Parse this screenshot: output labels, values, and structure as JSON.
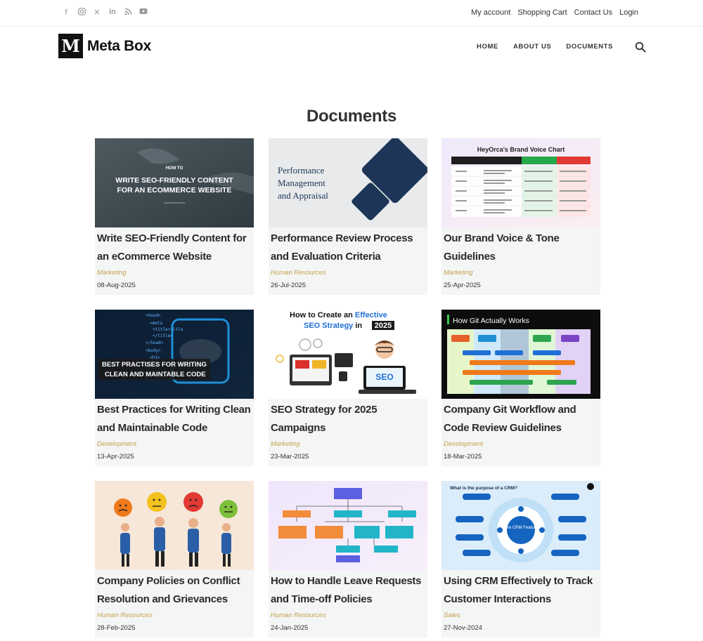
{
  "top_links": [
    "My account",
    "Shopping Cart",
    "Contact Us",
    "Login"
  ],
  "social_icons": [
    "facebook-icon",
    "instagram-icon",
    "x-icon",
    "linkedin-icon",
    "rss-icon",
    "youtube-icon"
  ],
  "logo": {
    "mark": "M",
    "text": "Meta Box"
  },
  "nav": [
    "HOME",
    "ABOUT US",
    "DOCUMENTS"
  ],
  "page_title": "Documents",
  "colors": {
    "category": "#c2a24a",
    "card_bg": "#f4f5f5",
    "text": "#2a2a2a"
  },
  "cards": [
    {
      "title": "Write SEO-Friendly Content for an eCommerce Website",
      "category": "Marketing",
      "date": "08-Aug-2025",
      "image": {
        "kicker": "HOW TO",
        "line1": "WRITE SEO-FRIENDLY CONTENT",
        "line2": "FOR AN ECOMMERCE WEBSITE"
      }
    },
    {
      "title": "Performance Review Process and Evaluation Criteria",
      "category": "Human Resources",
      "date": "26-Jul-2025",
      "image": {
        "line1": "Performance",
        "line2": "Management",
        "line3": "and Appraisal"
      }
    },
    {
      "title": "Our Brand Voice & Tone Guidelines",
      "category": "Marketing",
      "date": "25-Apr-2025",
      "image": {
        "heading": "HeyOrca's Brand Voice Chart"
      }
    },
    {
      "title": "Best Practices for Writing Clean and Maintainable Code",
      "category": "Development",
      "date": "13-Apr-2025",
      "image": {
        "line1": "BEST PRACTISES FOR WRITING",
        "line2": "CLEAN AND MAINTABLE CODE",
        "code": [
          "<head>",
          "<meta",
          "<title>title",
          "</title>",
          "</head>",
          "<body>",
          "<h1>"
        ]
      }
    },
    {
      "title": "SEO Strategy for 2025 Campaigns",
      "category": "Marketing",
      "date": "23-Mar-2025",
      "image": {
        "line1a": "How to Create an ",
        "line1b": "Effective",
        "line2a": "SEO Strategy",
        "line2b": " in ",
        "line2c": "2025",
        "badge": "SEO"
      }
    },
    {
      "title": "Company Git Workflow and Code Review Guidelines",
      "category": "Development",
      "date": "18-Mar-2025",
      "image": {
        "heading": "How Git Actually Works"
      }
    },
    {
      "title": "Company Policies on Conflict Resolution and Grievances",
      "category": "Human Resources",
      "date": "28-Feb-2025",
      "image": {}
    },
    {
      "title": "How to Handle Leave Requests and Time-off Policies",
      "category": "Human Resources",
      "date": "24-Jan-2025",
      "image": {}
    },
    {
      "title": "Using CRM Effectively to Track Customer Interactions",
      "category": "Sales",
      "date": "27-Nov-2024",
      "image": {
        "heading": "What is the purpose of a CRM?",
        "center": "Core CRM Features"
      }
    }
  ]
}
